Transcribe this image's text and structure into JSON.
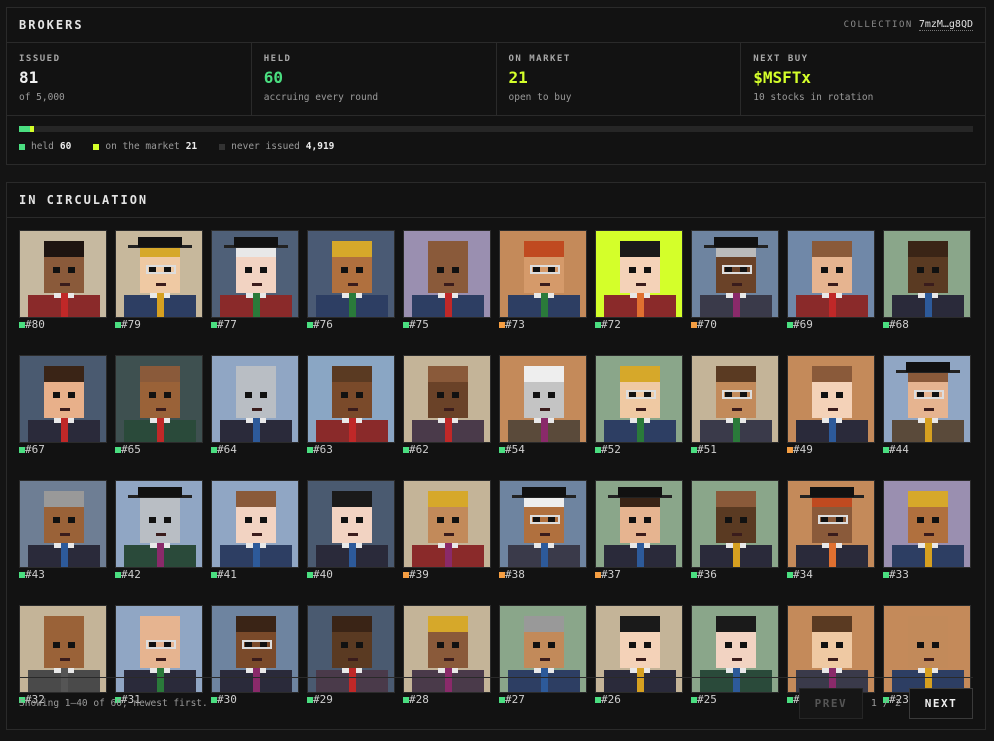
{
  "header": {
    "title": "BROKERS",
    "collection_label": "COLLECTION",
    "collection_addr": "7mzM…g8QD"
  },
  "stats": [
    {
      "label": "ISSUED",
      "value": "81",
      "sub": "of 5,000",
      "color": "#f0f0f0"
    },
    {
      "label": "HELD",
      "value": "60",
      "sub": "accruing every round",
      "color": "#4ade80"
    },
    {
      "label": "ON MARKET",
      "value": "21",
      "sub": "open to buy",
      "color": "#d4ff2a"
    },
    {
      "label": "NEXT BUY",
      "value": "$MSFTx",
      "sub": "10 stocks in rotation",
      "color": "#d4ff2a"
    }
  ],
  "supply": {
    "total": 5000,
    "held": 60,
    "market": 21
  },
  "legend": [
    {
      "label": "held",
      "value": "60",
      "color": "#4ade80"
    },
    {
      "label": "on the market",
      "value": "21",
      "color": "#d4ff2a"
    },
    {
      "label": "never issued",
      "value": "4,919",
      "color": "#333333"
    }
  ],
  "circulation": {
    "title": "IN CIRCULATION",
    "showing": "Showing 1–40 of 60, newest first.",
    "prev_label": "PREV",
    "next_label": "NEXT",
    "page": "1 / 2"
  },
  "colors": {
    "held": "#4ade80",
    "market": "#f59e42"
  },
  "brokers": [
    {
      "id": "#80",
      "status": "held",
      "bg": "#c6b9a0",
      "skin": "#8a5a3a",
      "hair": "#1e1410",
      "tie": "#c02828",
      "suit": "#8a2a2a"
    },
    {
      "id": "#79",
      "status": "held",
      "bg": "#c7b89c",
      "skin": "#efc9a3",
      "hair": "#d6a82a",
      "tie": "#d6a020",
      "suit": "#2d3e63",
      "glasses": true,
      "hat": true
    },
    {
      "id": "#77",
      "status": "held",
      "bg": "#4f6078",
      "skin": "#f2d3c2",
      "hair": "#e8e8e8",
      "tie": "#2a7a3a",
      "suit": "#8a2a2a",
      "hat": true
    },
    {
      "id": "#76",
      "status": "held",
      "bg": "#4a5a74",
      "skin": "#b0703e",
      "hair": "#d6a82a",
      "tie": "#2a7a3a",
      "suit": "#2d3e63"
    },
    {
      "id": "#75",
      "status": "held",
      "bg": "#9a8fb0",
      "skin": "#8a5a3a",
      "hair": "#8a5a3a",
      "tie": "#c02828",
      "suit": "#2d3e63"
    },
    {
      "id": "#73",
      "status": "market",
      "bg": "#c48a5a",
      "skin": "#d59a6a",
      "hair": "#c04a20",
      "tie": "#2a7a3a",
      "suit": "#2d3e63",
      "glasses": true
    },
    {
      "id": "#72",
      "status": "held",
      "bg": "#d4ff2a",
      "skin": "#f4d2b8",
      "hair": "#1a1a1a",
      "tie": "#e07030",
      "suit": "#8a2a2a"
    },
    {
      "id": "#70",
      "status": "market",
      "bg": "#6e84a0",
      "skin": "#6a4228",
      "hair": "#bbbbbb",
      "tie": "#8a2a6a",
      "suit": "#3a3a4a",
      "glasses": true,
      "hat": true
    },
    {
      "id": "#69",
      "status": "held",
      "bg": "#7088a8",
      "skin": "#e6b490",
      "hair": "#8a5a3a",
      "tie": "#c02828",
      "suit": "#8a2a2a"
    },
    {
      "id": "#68",
      "status": "held",
      "bg": "#8aa68a",
      "skin": "#5a3a22",
      "hair": "#3a2416",
      "tie": "#2d5a9a",
      "suit": "#2a2a3a"
    },
    {
      "id": "#67",
      "status": "held",
      "bg": "#4a5a70",
      "skin": "#e8b08a",
      "hair": "#3a2416",
      "tie": "#c02828",
      "suit": "#2a2a3a"
    },
    {
      "id": "#65",
      "status": "held",
      "bg": "#3e5050",
      "skin": "#9a6238",
      "hair": "#8a5a3a",
      "tie": "#c02828",
      "suit": "#2a4a3a"
    },
    {
      "id": "#64",
      "status": "held",
      "bg": "#90a6c4",
      "skin": "#b9bec4",
      "hair": "#b9bec4",
      "tie": "#2d5a9a",
      "suit": "#2a2a3a"
    },
    {
      "id": "#63",
      "status": "held",
      "bg": "#8aa6c4",
      "skin": "#7a4a2a",
      "hair": "#5a3a22",
      "tie": "#c02828",
      "suit": "#8a2a2a"
    },
    {
      "id": "#62",
      "status": "held",
      "bg": "#c4b498",
      "skin": "#6a4228",
      "hair": "#8a5a3a",
      "tie": "#c02828",
      "suit": "#4a3a4a"
    },
    {
      "id": "#54",
      "status": "held",
      "bg": "#c48a5a",
      "skin": "#c4c4c4",
      "hair": "#eeeeee",
      "tie": "#8a2a6a",
      "suit": "#5a4a3a"
    },
    {
      "id": "#52",
      "status": "held",
      "bg": "#8aa68a",
      "skin": "#efc9a3",
      "hair": "#d6a82a",
      "tie": "#2a7a3a",
      "suit": "#2d3e63",
      "glasses": true
    },
    {
      "id": "#51",
      "status": "held",
      "bg": "#c4b498",
      "skin": "#c28a5a",
      "hair": "#5a3a22",
      "tie": "#2a7a3a",
      "suit": "#3a3a4a",
      "glasses": true
    },
    {
      "id": "#49",
      "status": "market",
      "bg": "#c48a5a",
      "skin": "#f4d2b8",
      "hair": "#8a5a3a",
      "tie": "#2d5a9a",
      "suit": "#2a2a3a"
    },
    {
      "id": "#44",
      "status": "held",
      "bg": "#90a6c4",
      "skin": "#e6b490",
      "hair": "#8a5a3a",
      "tie": "#d6a020",
      "suit": "#5a4a3a",
      "glasses": true,
      "hat": true
    },
    {
      "id": "#43",
      "status": "held",
      "bg": "#6e7e94",
      "skin": "#9a6238",
      "hair": "#999999",
      "tie": "#2d5a9a",
      "suit": "#2a2a3a"
    },
    {
      "id": "#42",
      "status": "held",
      "bg": "#90a6c4",
      "skin": "#b9bec4",
      "hair": "#b9bec4",
      "tie": "#8a2a6a",
      "suit": "#2a4a3a",
      "hat": true
    },
    {
      "id": "#41",
      "status": "held",
      "bg": "#90a6c4",
      "skin": "#f2d3c2",
      "hair": "#8a5a3a",
      "tie": "#2d5a9a",
      "suit": "#2d3e63"
    },
    {
      "id": "#40",
      "status": "held",
      "bg": "#4a5a70",
      "skin": "#f2d3c2",
      "hair": "#1a1a1a",
      "tie": "#2d5a9a",
      "suit": "#2a2a3a"
    },
    {
      "id": "#39",
      "status": "market",
      "bg": "#c4b498",
      "skin": "#c28a5a",
      "hair": "#d6a82a",
      "tie": "#8a2a6a",
      "suit": "#8a2a2a"
    },
    {
      "id": "#38",
      "status": "market",
      "bg": "#6e84a0",
      "skin": "#b0703e",
      "hair": "#eeeeee",
      "tie": "#2d5a9a",
      "suit": "#3a3a4a",
      "glasses": true,
      "hat": true
    },
    {
      "id": "#37",
      "status": "market",
      "bg": "#8aa68a",
      "skin": "#e6b490",
      "hair": "#3a2416",
      "tie": "#2d5a9a",
      "suit": "#2a2a3a",
      "hat": true
    },
    {
      "id": "#36",
      "status": "held",
      "bg": "#8aa68a",
      "skin": "#5a3a22",
      "hair": "#8a5a3a",
      "tie": "#d6a020",
      "suit": "#2a2a3a"
    },
    {
      "id": "#34",
      "status": "held",
      "bg": "#c48a5a",
      "skin": "#8a5a3a",
      "hair": "#c04a20",
      "tie": "#e07030",
      "suit": "#2a2a3a",
      "glasses": true,
      "hat": true
    },
    {
      "id": "#33",
      "status": "held",
      "bg": "#9a8fb0",
      "skin": "#b0703e",
      "hair": "#d6a82a",
      "tie": "#d6a020",
      "suit": "#2d3e63"
    },
    {
      "id": "#32",
      "status": "held",
      "bg": "#c4b498",
      "skin": "#9a6238",
      "hair": "#9a6238",
      "tie": "#555555",
      "suit": "#4a4a4a"
    },
    {
      "id": "#31",
      "status": "held",
      "bg": "#90a6c4",
      "skin": "#e6b490",
      "hair": "#e6b490",
      "tie": "#2a7a3a",
      "suit": "#2a2a3a",
      "glasses": true
    },
    {
      "id": "#30",
      "status": "held",
      "bg": "#6e84a0",
      "skin": "#7a4a2a",
      "hair": "#3a2416",
      "tie": "#8a2a6a",
      "suit": "#2a2a3a",
      "glasses": true
    },
    {
      "id": "#29",
      "status": "held",
      "bg": "#4a5a70",
      "skin": "#5a3a22",
      "hair": "#3a2416",
      "tie": "#c02828",
      "suit": "#4a3a4a"
    },
    {
      "id": "#28",
      "status": "held",
      "bg": "#c4b498",
      "skin": "#8a5a3a",
      "hair": "#d6a82a",
      "tie": "#8a2a6a",
      "suit": "#4a3a4a"
    },
    {
      "id": "#27",
      "status": "held",
      "bg": "#8aa68a",
      "skin": "#c28a5a",
      "hair": "#999999",
      "tie": "#2d5a9a",
      "suit": "#2d3e63"
    },
    {
      "id": "#26",
      "status": "held",
      "bg": "#c4b498",
      "skin": "#f4d2b8",
      "hair": "#1a1a1a",
      "tie": "#d6a020",
      "suit": "#2a2a3a"
    },
    {
      "id": "#25",
      "status": "held",
      "bg": "#8aa68a",
      "skin": "#f2d3c2",
      "hair": "#1a1a1a",
      "tie": "#2d5a9a",
      "suit": "#2a4a3a"
    },
    {
      "id": "#24",
      "status": "held",
      "bg": "#c48a5a",
      "skin": "#efc9a3",
      "hair": "#5a3a22",
      "tie": "#8a2a6a",
      "suit": "#3a3a4a"
    },
    {
      "id": "#23",
      "status": "held",
      "bg": "#c48a5a",
      "skin": "#c28a5a",
      "hair": "#c28a5a",
      "tie": "#d6a020",
      "suit": "#2d3e63"
    }
  ]
}
